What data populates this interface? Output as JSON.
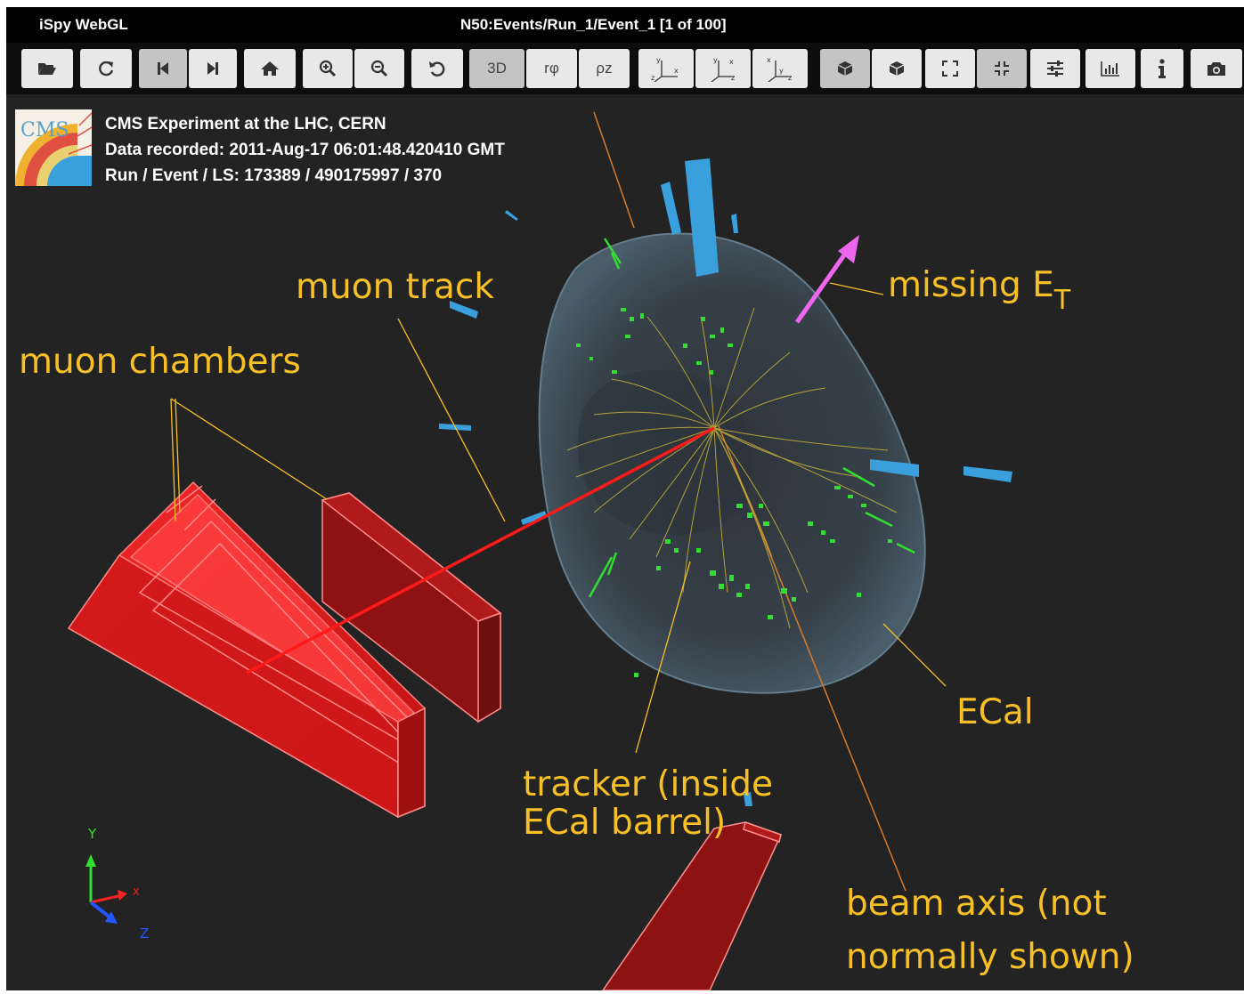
{
  "titlebar": {
    "app_title": "iSpy WebGL",
    "event_path": "N50:Events/Run_1/Event_1 [1 of 100]"
  },
  "toolbar": {
    "view_3d": "3D",
    "view_rphi": "rφ",
    "view_rhoz": "ρz",
    "icons": [
      "folder-open-icon",
      "reload-icon",
      "step-backward-icon",
      "step-forward-icon",
      "home-icon",
      "zoom-in-icon",
      "zoom-out-icon",
      "undo-icon",
      "view-3d-button",
      "view-rphi-button",
      "view-rhoz-button",
      "view-xy-icon",
      "view-xz-icon",
      "view-zy-icon",
      "perspective-icon",
      "orthographic-icon",
      "fullscreen-icon",
      "exit-fullscreen-icon",
      "settings-sliders-icon",
      "chart-icon",
      "info-icon",
      "camera-icon"
    ]
  },
  "event_info": {
    "logo_text": "CMS",
    "line1": "CMS Experiment at the LHC, CERN",
    "line2": "Data recorded: 2011-Aug-17 06:01:48.420410 GMT",
    "line3": "Run / Event / LS: 173389 / 490175997 / 370"
  },
  "annotations": {
    "muon_track": "muon track",
    "muon_chambers": "muon chambers",
    "missing_et": "missing E",
    "missing_et_sub": "T",
    "ecal": "ECal",
    "tracker_line1": "tracker (inside",
    "tracker_line2": "ECal barrel)",
    "beam_line1": "beam axis (not",
    "beam_line2": "normally shown)"
  },
  "axes": {
    "y": "Y",
    "x": "X",
    "z": "Z"
  },
  "colors": {
    "annotation": "#f6c026",
    "muon": "#ff1a1a",
    "hits": "#33dd33",
    "ecal": "#3aa0dd",
    "met": "#ee66ee"
  }
}
